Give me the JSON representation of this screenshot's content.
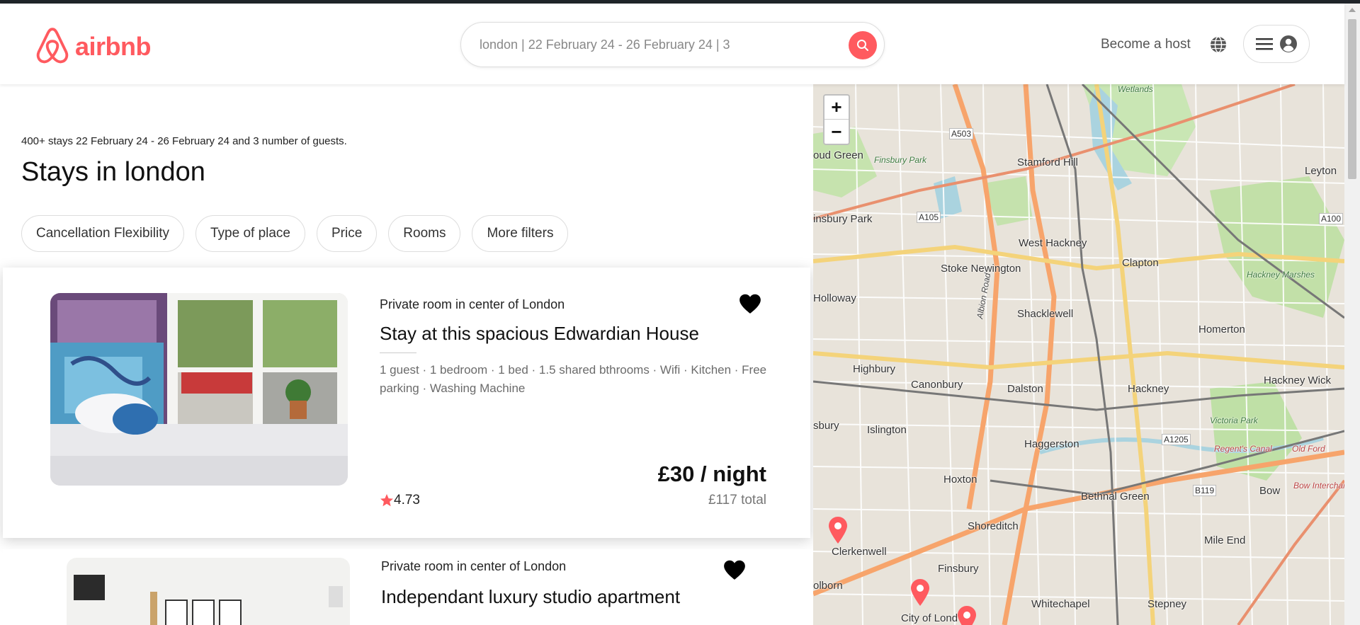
{
  "brand": {
    "name": "airbnb",
    "color": "#ff5a5f"
  },
  "search": {
    "value": "london | 22 February 24 - 26 February 24 | 3",
    "icon": "search-icon"
  },
  "header": {
    "host_label": "Become a host",
    "globe_icon": "globe-icon",
    "menu_icon": "hamburger-icon",
    "avatar_icon": "user-avatar-icon"
  },
  "results": {
    "summary": "400+ stays 22 February 24 - 26 February 24 and 3 number of guests.",
    "title": "Stays in london"
  },
  "filters": [
    "Cancellation Flexibility",
    "Type of place",
    "Price",
    "Rooms",
    "More filters"
  ],
  "listings": [
    {
      "subtitle": "Private room in center of London",
      "title": "Stay at this spacious Edwardian House",
      "description": "1 guest · 1 bedroom · 1 bed · 1.5 shared bthrooms · Wifi · Kitchen · Free parking · Washing Machine",
      "price": "£30 / night",
      "total": "£117 total",
      "rating": "4.73"
    },
    {
      "subtitle": "Private room in center of London",
      "title": "Independant luxury studio apartment"
    }
  ],
  "map": {
    "zoom_in": "+",
    "zoom_out": "−",
    "labels": {
      "wetlands": "Wetlands",
      "a503": "A503",
      "stamford_hill": "Stamford Hill",
      "leyton": "Leyton",
      "oud_green": "oud Green",
      "finsbury_park_green": "Finsbury Park",
      "a105": "A105",
      "insbury_park": "insbury Park",
      "west_hackney": "West Hackney",
      "clapton": "Clapton",
      "stoke_newington": "Stoke Newington",
      "holloway": "Holloway",
      "albion_road": "Albion Road",
      "hackney_marshes": "Hackney Marshes",
      "shacklewell": "Shacklewell",
      "homerton": "Homerton",
      "highbury": "Highbury",
      "canonbury": "Canonbury",
      "dalston": "Dalston",
      "hackney": "Hackney",
      "hackney_wick": "Hackney Wick",
      "islington": "Islington",
      "sbury": "sbury",
      "haggerston": "Haggerston",
      "victoria_park": "Victoria Park",
      "a1205": "A1205",
      "old_ford": "Old Ford",
      "hoxton": "Hoxton",
      "bethnal_green": "Bethnal Green",
      "b119": "B119",
      "bow": "Bow",
      "bow_interchange": "Bow Interchange",
      "shoreditch": "Shoreditch",
      "clerkenwell": "Clerkenwell",
      "mile_end": "Mile End",
      "finsbury": "Finsbury",
      "olborn": "olborn",
      "whitechapel": "Whitechapel",
      "stepney": "Stepney",
      "city_of_london": "City of Lond",
      "a100": "A100",
      "regents_canal": "Regent's Canal"
    }
  },
  "colors": {
    "accent": "#ff5a5f",
    "heart": "#000000",
    "star": "#ff5a5f"
  }
}
